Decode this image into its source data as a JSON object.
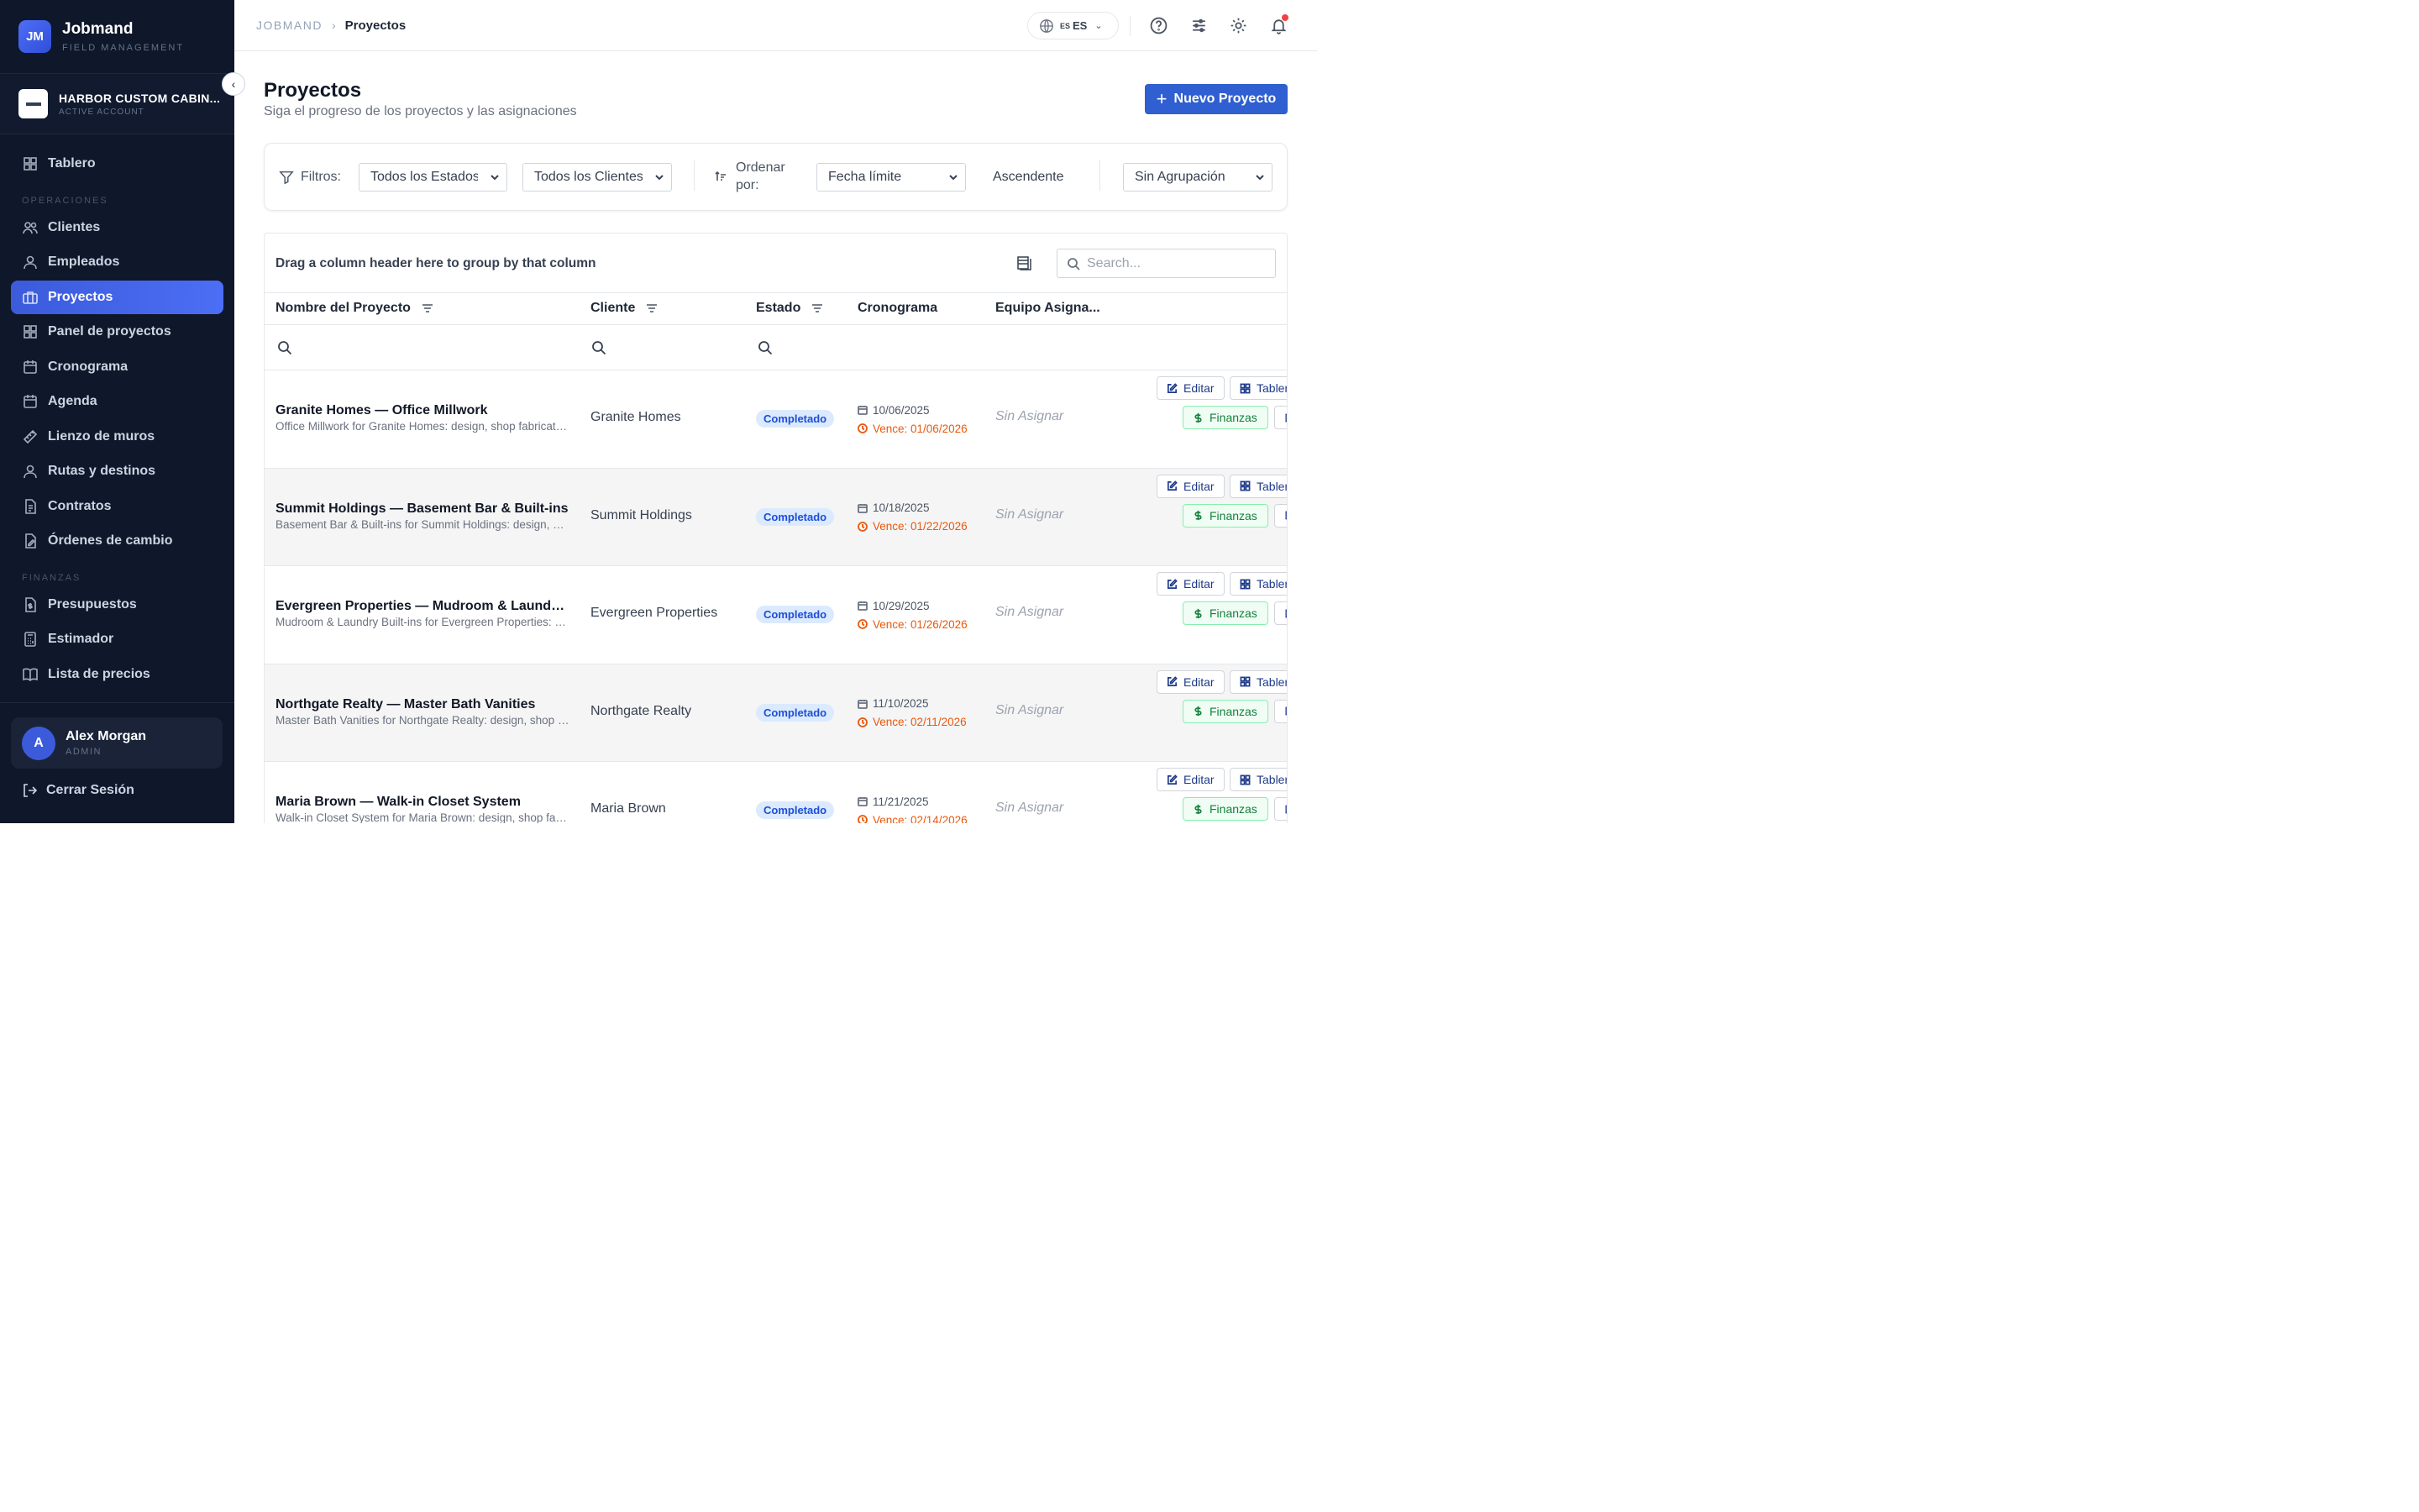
{
  "brand": {
    "logo": "JM",
    "name": "Jobmand",
    "sub": "FIELD MANAGEMENT"
  },
  "account": {
    "name": "HARBOR CUSTOM CABIN...",
    "sub": "ACTIVE ACCOUNT"
  },
  "nav": {
    "dashboard": "Tablero",
    "section_ops": "OPERACIONES",
    "clients": "Clientes",
    "employees": "Empleados",
    "projects": "Proyectos",
    "projects_panel": "Panel de proyectos",
    "schedule": "Cronograma",
    "agenda": "Agenda",
    "wall_canvas": "Lienzo de muros",
    "routes": "Rutas y destinos",
    "contracts": "Contratos",
    "change_orders": "Órdenes de cambio",
    "section_fin": "FINANZAS",
    "budgets": "Presupuestos",
    "estimator": "Estimador",
    "price_list": "Lista de precios"
  },
  "user": {
    "initial": "A",
    "name": "Alex Morgan",
    "role": "ADMIN"
  },
  "logout": "Cerrar Sesión",
  "breadcrumb": {
    "root": "JOBMAND",
    "current": "Proyectos"
  },
  "lang": {
    "flag": "ES",
    "code": "ES"
  },
  "page": {
    "title": "Proyectos",
    "subtitle": "Siga el progreso de los proyectos y las asignaciones",
    "new_button": "Nuevo Proyecto"
  },
  "filters": {
    "label": "Filtros:",
    "status": "Todos los Estados",
    "client": "Todos los Clientes",
    "sort_label_1": "Ordenar",
    "sort_label_2": "por:",
    "sort_by": "Fecha límite",
    "direction": "Ascendente",
    "grouping": "Sin Agrupación"
  },
  "grid": {
    "group_hint": "Drag a column header here to group by that column",
    "search_placeholder": "Search...",
    "columns": {
      "name": "Nombre del Proyecto",
      "client": "Cliente",
      "status": "Estado",
      "schedule": "Cronograma",
      "team": "Equipo Asigna..."
    },
    "actions": {
      "edit": "Editar",
      "board": "Tablero",
      "finance": "Finanzas"
    },
    "rows": [
      {
        "title": "Granite Homes — Office Millwork",
        "desc": "Office Millwork for Granite Homes: design, shop fabrication and installation",
        "client": "Granite Homes",
        "status": "Completado",
        "start": "10/06/2025",
        "due": "Vence: 01/06/2026",
        "team": "Sin Asignar"
      },
      {
        "title": "Summit Holdings — Basement Bar & Built-ins",
        "desc": "Basement Bar & Built-ins for Summit Holdings: design, shop fabrication",
        "client": "Summit Holdings",
        "status": "Completado",
        "start": "10/18/2025",
        "due": "Vence: 01/22/2026",
        "team": "Sin Asignar"
      },
      {
        "title": "Evergreen Properties — Mudroom & Laundry Built-ins",
        "desc": "Mudroom & Laundry Built-ins for Evergreen Properties: design",
        "client": "Evergreen Properties",
        "status": "Completado",
        "start": "10/29/2025",
        "due": "Vence: 01/26/2026",
        "team": "Sin Asignar"
      },
      {
        "title": "Northgate Realty — Master Bath Vanities",
        "desc": "Master Bath Vanities for Northgate Realty: design, shop fabrication",
        "client": "Northgate Realty",
        "status": "Completado",
        "start": "11/10/2025",
        "due": "Vence: 02/11/2026",
        "team": "Sin Asignar"
      },
      {
        "title": "Maria Brown — Walk-in Closet System",
        "desc": "Walk-in Closet System for Maria Brown: design, shop fabrication",
        "client": "Maria Brown",
        "status": "Completado",
        "start": "11/21/2025",
        "due": "Vence: 02/14/2026",
        "team": "Sin Asignar"
      }
    ]
  }
}
